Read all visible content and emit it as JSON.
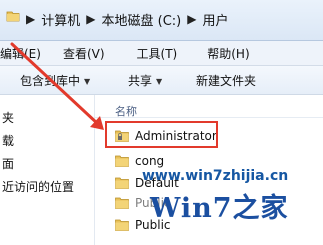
{
  "address": {
    "crumbs": [
      "计算机",
      "本地磁盘 (C:)",
      "用户"
    ],
    "separator": "▶",
    "folder_icon": "folder-icon"
  },
  "menu": {
    "items": [
      "编辑(E)",
      "查看(V)",
      "工具(T)",
      "帮助(H)"
    ]
  },
  "toolbar": {
    "include_library": "包含到库中",
    "share": "共享",
    "new_folder": "新建文件夹"
  },
  "nav": {
    "items": [
      "夹",
      "载",
      "面",
      "近访问的位置"
    ]
  },
  "list": {
    "column_name": "名称",
    "files": [
      "Administrator",
      "cong",
      "Default",
      "Public"
    ],
    "partially_visible": "Public"
  },
  "watermark": {
    "url": "www.win7zhijia.cn",
    "logo": "Win7之家"
  },
  "colors": {
    "highlight": "#e23a2c",
    "arrow": "#e23a2c",
    "watermark": "#1b4fa0"
  }
}
